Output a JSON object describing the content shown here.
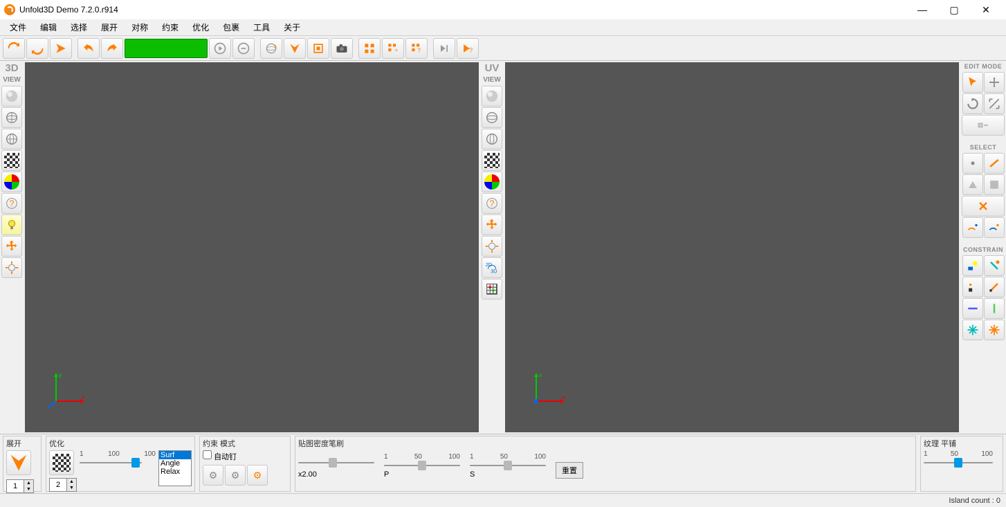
{
  "window": {
    "title": "Unfold3D Demo 7.2.0.r914"
  },
  "menus": [
    "文件",
    "编辑",
    "选择",
    "展开",
    "对称",
    "约束",
    "优化",
    "包裹",
    "工具",
    "关于"
  ],
  "left3d": {
    "big": "3D",
    "view": "VIEW"
  },
  "leftuv": {
    "big": "UV",
    "view": "VIEW"
  },
  "right": {
    "edit": "EDIT MODE",
    "select": "SELECT",
    "constrain": "CONSTRAIN"
  },
  "bottom": {
    "unfold": {
      "title": "展开",
      "spin": "1"
    },
    "optimize": {
      "title": "优化",
      "spin": "2",
      "t1": "1",
      "t2": "100",
      "t3": "100",
      "list": [
        "Surf",
        "Angle",
        "Relax"
      ]
    },
    "constrain": {
      "title": "约束 模式",
      "autopin": "自动钉"
    },
    "brush": {
      "title": "贴图密度笔刷",
      "x": "x2.00",
      "p": "P",
      "s": "S",
      "t1": "1",
      "t2": "50",
      "t3": "100",
      "reset": "重置"
    },
    "texture": {
      "title": "纹理 平铺",
      "t1": "1",
      "t2": "50",
      "t3": "100"
    }
  },
  "status": {
    "island": "Island count : 0"
  },
  "axis": {
    "x": "x",
    "y": "y",
    "u": "u",
    "v": "v"
  }
}
